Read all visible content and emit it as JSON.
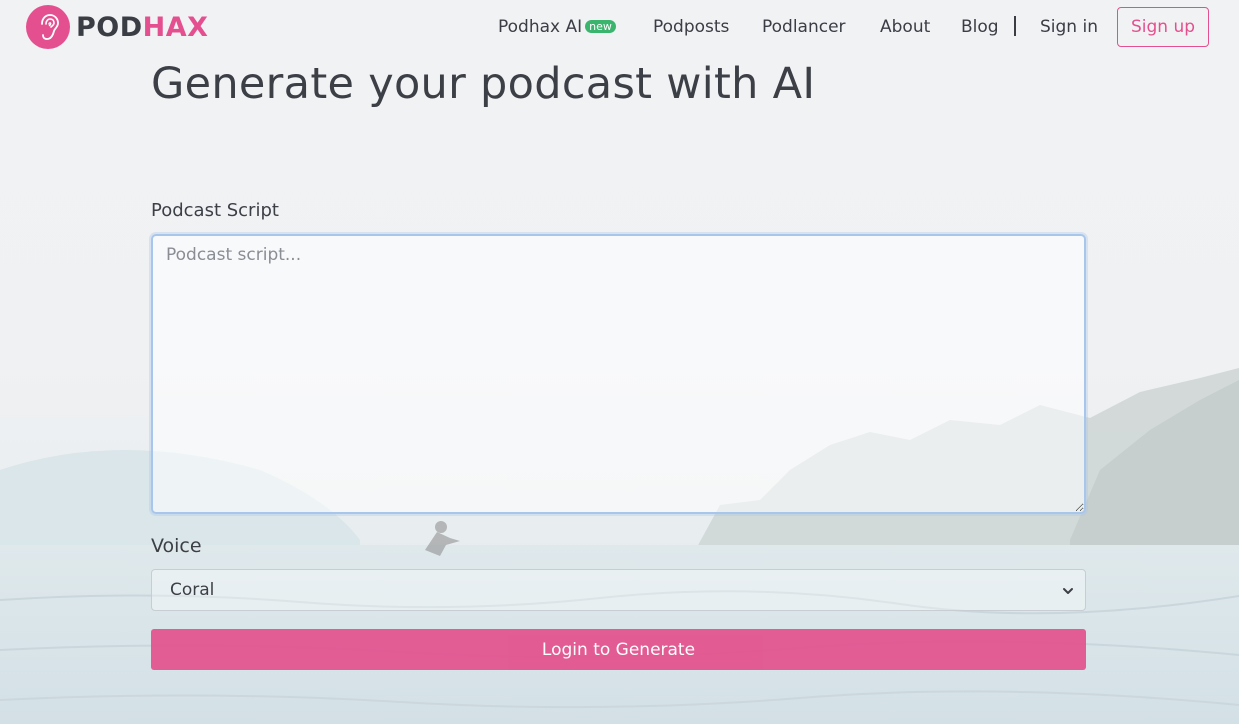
{
  "brand": {
    "name_part1": "POD",
    "name_part2": "HAX",
    "accent_color": "#e4508f",
    "logo_icon": "ear-icon"
  },
  "nav": {
    "items": [
      {
        "label": "Podhax AI",
        "badge": "new"
      },
      {
        "label": "Podposts"
      },
      {
        "label": "Podlancer"
      },
      {
        "label": "About"
      },
      {
        "label": "Blog"
      }
    ],
    "sign_in": "Sign in",
    "sign_up": "Sign up"
  },
  "main": {
    "title": "Generate your podcast with AI",
    "script_label": "Podcast Script",
    "script_placeholder": "Podcast script...",
    "script_value": "",
    "voice_label": "Voice",
    "voice_selected": "Coral",
    "generate_button": "Login to Generate"
  },
  "colors": {
    "badge_green": "#3bb46e",
    "button_pink": "#e3558f",
    "focus_border": "#a8c6ec"
  }
}
